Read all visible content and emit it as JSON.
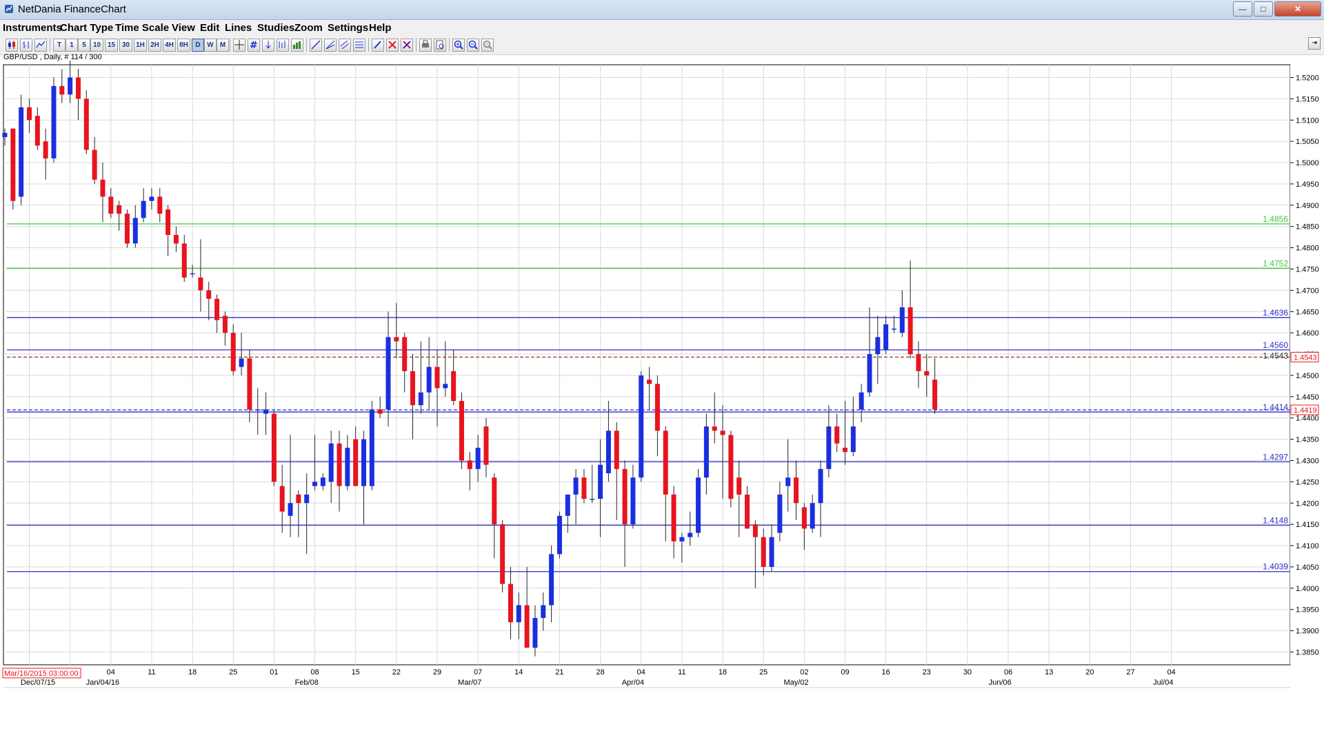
{
  "window": {
    "title": "NetDania FinanceChart",
    "minimize_label": "—",
    "maximize_label": "□",
    "close_label": "✕"
  },
  "menu": [
    "Instruments",
    "Chart Type",
    "Time Scale",
    "View",
    "Edit",
    "Lines",
    "Studies",
    "Zoom",
    "Settings",
    "Help"
  ],
  "toolbar": {
    "timescale_buttons": [
      "T",
      "1",
      "5",
      "10",
      "15",
      "30",
      "1H",
      "2H",
      "4H",
      "8H",
      "D",
      "W",
      "M"
    ],
    "selected_timescale": "D",
    "icons": [
      "candlestick-chart-icon",
      "bar-chart-icon",
      "line-chart-icon",
      "crosshair-icon",
      "grid-icon",
      "arrow-down-icon",
      "studies-icon",
      "volume-icon",
      "trendline-icon",
      "fan-icon",
      "channel-icon",
      "fibonacci-icon",
      "pencil-delete-icon",
      "delete-icon",
      "delete-all-icon",
      "print-icon",
      "print-preview-icon",
      "zoom-in-icon",
      "zoom-out-icon",
      "zoom-reset-icon"
    ],
    "collapse_label": "⇥"
  },
  "chart_header": "GBP/USD , Daily, # 114 / 300",
  "cursor_date_box": "Mar/16/2015 03:00:00",
  "colors": {
    "up": "#1a2fe0",
    "down": "#e8141e",
    "blue_line": "#2d2dc8",
    "green_line": "#3cc43c",
    "grid": "#d8d8d8",
    "dashed": "#8a3a1a"
  },
  "chart_data": {
    "type": "candlestick",
    "instrument": "GBP/USD",
    "timeframe": "Daily",
    "ylim": [
      1.382,
      1.523
    ],
    "y_ticks": [
      1.385,
      1.39,
      1.395,
      1.4,
      1.405,
      1.41,
      1.415,
      1.42,
      1.425,
      1.43,
      1.435,
      1.44,
      1.445,
      1.45,
      1.455,
      1.46,
      1.465,
      1.47,
      1.475,
      1.48,
      1.485,
      1.49,
      1.495,
      1.5,
      1.505,
      1.51,
      1.515,
      1.52
    ],
    "y_tick_labels": [
      "1.3850",
      "1.3900",
      "1.3950",
      "1.4000",
      "1.4050",
      "1.4100",
      "1.4150",
      "1.4200",
      "1.4250",
      "1.4300",
      "1.4350",
      "1.4400",
      "1.4450",
      "1.4500",
      "1.4550",
      "1.4600",
      "1.4650",
      "1.4700",
      "1.4750",
      "1.4800",
      "1.4850",
      "1.4900",
      "1.4950",
      "1.5000",
      "1.5050",
      "1.5100",
      "1.5150",
      "1.5200"
    ],
    "x_tick_labels": [
      "14",
      "21",
      "28",
      "04",
      "11",
      "18",
      "25",
      "01",
      "08",
      "15",
      "22",
      "29",
      "07",
      "14",
      "21",
      "28",
      "04",
      "11",
      "18",
      "25",
      "02",
      "09",
      "16",
      "23",
      "30",
      "06",
      "13",
      "20",
      "27",
      "04"
    ],
    "x_tick_start_index": -2,
    "month_labels": [
      {
        "label": "Dec/07/15",
        "index": -8
      },
      {
        "label": "Jan/04/16",
        "index": 12
      },
      {
        "label": "Feb/08",
        "index": 37
      },
      {
        "label": "Mar/07",
        "index": 57
      },
      {
        "label": "Apr/04",
        "index": 77
      },
      {
        "label": "May/02",
        "index": 97
      }
    ],
    "horizontal_lines": [
      {
        "value": 1.4856,
        "label": "1.4856",
        "color": "green"
      },
      {
        "value": 1.4752,
        "label": "1.4752",
        "color": "green"
      },
      {
        "value": 1.4636,
        "label": "1.4636",
        "color": "blue"
      },
      {
        "value": 1.456,
        "label": "1.4560",
        "color": "blue"
      },
      {
        "value": 1.4414,
        "label": "1.4414",
        "color": "blue"
      },
      {
        "value": 1.4297,
        "label": "1.4297",
        "color": "blue"
      },
      {
        "value": 1.4148,
        "label": "1.4148",
        "color": "blue"
      },
      {
        "value": 1.4039,
        "label": "1.4039",
        "color": "blue"
      }
    ],
    "dashed_lines": [
      {
        "value": 1.4543,
        "label": "1.4543",
        "box": "1.4543"
      },
      {
        "value": 1.4419,
        "label": "",
        "box": "1.4419"
      }
    ],
    "candles": [
      [
        1.506,
        1.508,
        1.504,
        1.507
      ],
      [
        1.508,
        1.508,
        1.489,
        1.491
      ],
      [
        1.492,
        1.516,
        1.49,
        1.513
      ],
      [
        1.513,
        1.515,
        1.507,
        1.51
      ],
      [
        1.511,
        1.513,
        1.503,
        1.504
      ],
      [
        1.505,
        1.508,
        1.496,
        1.501
      ],
      [
        1.501,
        1.52,
        1.5,
        1.518
      ],
      [
        1.518,
        1.522,
        1.514,
        1.516
      ],
      [
        1.516,
        1.524,
        1.514,
        1.52
      ],
      [
        1.52,
        1.522,
        1.51,
        1.515
      ],
      [
        1.515,
        1.517,
        1.502,
        1.503
      ],
      [
        1.503,
        1.506,
        1.495,
        1.496
      ],
      [
        1.496,
        1.5,
        1.486,
        1.492
      ],
      [
        1.492,
        1.494,
        1.487,
        1.488
      ],
      [
        1.49,
        1.491,
        1.484,
        1.488
      ],
      [
        1.488,
        1.489,
        1.48,
        1.481
      ],
      [
        1.481,
        1.49,
        1.48,
        1.487
      ],
      [
        1.487,
        1.494,
        1.486,
        1.491
      ],
      [
        1.491,
        1.494,
        1.489,
        1.492
      ],
      [
        1.492,
        1.494,
        1.486,
        1.488
      ],
      [
        1.489,
        1.49,
        1.478,
        1.483
      ],
      [
        1.483,
        1.485,
        1.479,
        1.481
      ],
      [
        1.481,
        1.483,
        1.472,
        1.473
      ],
      [
        1.474,
        1.476,
        1.473,
        1.474
      ],
      [
        1.473,
        1.482,
        1.465,
        1.47
      ],
      [
        1.47,
        1.472,
        1.463,
        1.468
      ],
      [
        1.468,
        1.469,
        1.46,
        1.463
      ],
      [
        1.464,
        1.465,
        1.457,
        1.46
      ],
      [
        1.46,
        1.462,
        1.45,
        1.451
      ],
      [
        1.452,
        1.46,
        1.45,
        1.454
      ],
      [
        1.454,
        1.456,
        1.439,
        1.442
      ],
      [
        1.442,
        1.447,
        1.436,
        1.442
      ],
      [
        1.441,
        1.446,
        1.436,
        1.442
      ],
      [
        1.441,
        1.442,
        1.424,
        1.425
      ],
      [
        1.424,
        1.429,
        1.413,
        1.418
      ],
      [
        1.417,
        1.436,
        1.412,
        1.42
      ],
      [
        1.422,
        1.423,
        1.412,
        1.42
      ],
      [
        1.42,
        1.427,
        1.408,
        1.422
      ],
      [
        1.424,
        1.436,
        1.423,
        1.425
      ],
      [
        1.424,
        1.427,
        1.423,
        1.426
      ],
      [
        1.425,
        1.437,
        1.42,
        1.434
      ],
      [
        1.434,
        1.437,
        1.418,
        1.424
      ],
      [
        1.424,
        1.436,
        1.423,
        1.433
      ],
      [
        1.435,
        1.438,
        1.424,
        1.424
      ],
      [
        1.424,
        1.437,
        1.415,
        1.435
      ],
      [
        1.424,
        1.444,
        1.423,
        1.442
      ],
      [
        1.442,
        1.445,
        1.44,
        1.441
      ],
      [
        1.442,
        1.465,
        1.438,
        1.459
      ],
      [
        1.459,
        1.467,
        1.454,
        1.458
      ],
      [
        1.459,
        1.46,
        1.446,
        1.451
      ],
      [
        1.451,
        1.455,
        1.435,
        1.443
      ],
      [
        1.443,
        1.458,
        1.441,
        1.446
      ],
      [
        1.446,
        1.459,
        1.442,
        1.452
      ],
      [
        1.452,
        1.456,
        1.438,
        1.447
      ],
      [
        1.447,
        1.458,
        1.445,
        1.448
      ],
      [
        1.451,
        1.456,
        1.443,
        1.444
      ],
      [
        1.444,
        1.446,
        1.428,
        1.43
      ],
      [
        1.43,
        1.432,
        1.423,
        1.428
      ],
      [
        1.428,
        1.436,
        1.425,
        1.433
      ],
      [
        1.438,
        1.44,
        1.426,
        1.429
      ],
      [
        1.426,
        1.427,
        1.407,
        1.415
      ],
      [
        1.415,
        1.416,
        1.399,
        1.401
      ],
      [
        1.401,
        1.405,
        1.388,
        1.392
      ],
      [
        1.392,
        1.399,
        1.388,
        1.396
      ],
      [
        1.396,
        1.405,
        1.386,
        1.386
      ],
      [
        1.386,
        1.396,
        1.384,
        1.393
      ],
      [
        1.393,
        1.399,
        1.39,
        1.396
      ],
      [
        1.396,
        1.41,
        1.392,
        1.408
      ],
      [
        1.408,
        1.418,
        1.407,
        1.417
      ],
      [
        1.417,
        1.422,
        1.413,
        1.422
      ],
      [
        1.422,
        1.428,
        1.415,
        1.426
      ],
      [
        1.426,
        1.428,
        1.42,
        1.421
      ],
      [
        1.421,
        1.429,
        1.42,
        1.421
      ],
      [
        1.421,
        1.435,
        1.412,
        1.429
      ],
      [
        1.427,
        1.444,
        1.425,
        1.437
      ],
      [
        1.437,
        1.439,
        1.416,
        1.428
      ],
      [
        1.428,
        1.43,
        1.405,
        1.415
      ],
      [
        1.415,
        1.429,
        1.414,
        1.426
      ],
      [
        1.426,
        1.451,
        1.425,
        1.45
      ],
      [
        1.449,
        1.452,
        1.442,
        1.448
      ],
      [
        1.448,
        1.45,
        1.431,
        1.437
      ],
      [
        1.437,
        1.438,
        1.411,
        1.422
      ],
      [
        1.422,
        1.424,
        1.407,
        1.411
      ],
      [
        1.411,
        1.413,
        1.406,
        1.412
      ],
      [
        1.412,
        1.418,
        1.41,
        1.413
      ],
      [
        1.413,
        1.428,
        1.412,
        1.426
      ],
      [
        1.426,
        1.441,
        1.422,
        1.438
      ],
      [
        1.438,
        1.446,
        1.434,
        1.437
      ],
      [
        1.437,
        1.443,
        1.421,
        1.436
      ],
      [
        1.436,
        1.437,
        1.419,
        1.421
      ],
      [
        1.426,
        1.43,
        1.412,
        1.422
      ],
      [
        1.422,
        1.424,
        1.414,
        1.414
      ],
      [
        1.415,
        1.416,
        1.4,
        1.412
      ],
      [
        1.412,
        1.414,
        1.403,
        1.405
      ],
      [
        1.405,
        1.415,
        1.404,
        1.412
      ],
      [
        1.413,
        1.425,
        1.411,
        1.422
      ],
      [
        1.424,
        1.435,
        1.418,
        1.426
      ],
      [
        1.426,
        1.43,
        1.416,
        1.42
      ],
      [
        1.419,
        1.42,
        1.409,
        1.414
      ],
      [
        1.414,
        1.422,
        1.413,
        1.42
      ],
      [
        1.42,
        1.43,
        1.412,
        1.428
      ],
      [
        1.428,
        1.443,
        1.426,
        1.438
      ],
      [
        1.438,
        1.441,
        1.432,
        1.434
      ],
      [
        1.433,
        1.444,
        1.429,
        1.432
      ],
      [
        1.432,
        1.445,
        1.431,
        1.438
      ],
      [
        1.442,
        1.448,
        1.439,
        1.446
      ],
      [
        1.446,
        1.466,
        1.445,
        1.455
      ],
      [
        1.455,
        1.464,
        1.448,
        1.459
      ],
      [
        1.456,
        1.464,
        1.455,
        1.462
      ],
      [
        1.461,
        1.464,
        1.46,
        1.461
      ],
      [
        1.46,
        1.47,
        1.459,
        1.466
      ],
      [
        1.466,
        1.477,
        1.454,
        1.455
      ],
      [
        1.455,
        1.458,
        1.447,
        1.451
      ],
      [
        1.451,
        1.455,
        1.445,
        1.45
      ],
      [
        1.449,
        1.454,
        1.441,
        1.442
      ]
    ]
  }
}
